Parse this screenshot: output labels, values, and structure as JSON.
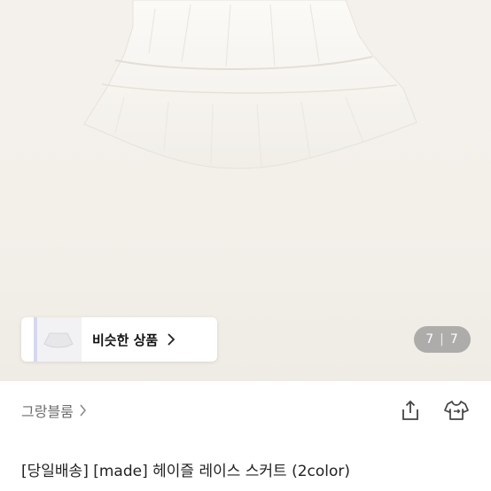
{
  "gallery": {
    "current": "7",
    "separator": "|",
    "total": "7"
  },
  "similar": {
    "label": "비슷한 상품"
  },
  "store": {
    "name": "그랑블룸"
  },
  "product": {
    "title": "[당일배송] [made] 헤이즐 레이스 스커트 (2color)"
  },
  "colors": {
    "hero_bg": "#f3f0ea",
    "text_primary": "#222222",
    "text_secondary": "#6b6b6b",
    "counter_bg": "#8a8a8a"
  }
}
